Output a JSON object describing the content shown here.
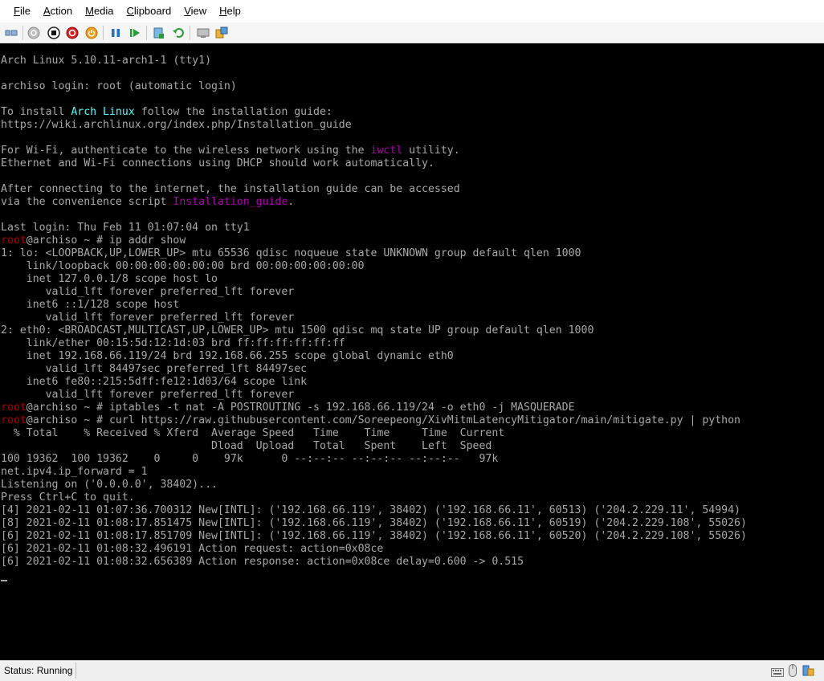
{
  "menu": [
    "File",
    "Action",
    "Media",
    "Clipboard",
    "View",
    "Help"
  ],
  "menu_underline": [
    "F",
    "A",
    "M",
    "C",
    "V",
    "H"
  ],
  "toolbar_icons": [
    "ctrl-alt-del-icon",
    "start-icon",
    "turn-off-icon",
    "shut-down-icon",
    "power-icon",
    "pause-icon",
    "resume-icon",
    "checkpoint-icon",
    "revert-icon",
    "enhanced-session-icon",
    "share-icon"
  ],
  "terminal": {
    "lines": [
      [
        {
          "t": "Arch Linux 5.10.11-arch1-1 (tty1)"
        }
      ],
      [
        {
          "t": ""
        }
      ],
      [
        {
          "t": "archiso login: root (automatic login)"
        }
      ],
      [
        {
          "t": ""
        }
      ],
      [
        {
          "t": "To install "
        },
        {
          "t": "Arch Linux",
          "c": "hl-cyan"
        },
        {
          "t": " follow the installation guide:"
        }
      ],
      [
        {
          "t": "https://wiki.archlinux.org/index.php/Installation_guide"
        }
      ],
      [
        {
          "t": ""
        }
      ],
      [
        {
          "t": "For Wi-Fi, authenticate to the wireless network using the "
        },
        {
          "t": "iwctl",
          "c": "hl-mag"
        },
        {
          "t": " utility."
        }
      ],
      [
        {
          "t": "Ethernet and Wi-Fi connections using DHCP should work automatically."
        }
      ],
      [
        {
          "t": ""
        }
      ],
      [
        {
          "t": "After connecting to the internet, the installation guide can be accessed"
        }
      ],
      [
        {
          "t": "via the convenience script "
        },
        {
          "t": "Installation_guide",
          "c": "hl-mag"
        },
        {
          "t": "."
        }
      ],
      [
        {
          "t": ""
        }
      ],
      [
        {
          "t": "Last login: Thu Feb 11 01:07:04 on tty1"
        }
      ],
      [
        {
          "t": "root",
          "c": "red"
        },
        {
          "t": "@archiso ~ # ip addr show"
        }
      ],
      [
        {
          "t": "1: lo: <LOOPBACK,UP,LOWER_UP> mtu 65536 qdisc noqueue state UNKNOWN group default qlen 1000"
        }
      ],
      [
        {
          "t": "    link/loopback 00:00:00:00:00:00 brd 00:00:00:00:00:00"
        }
      ],
      [
        {
          "t": "    inet 127.0.0.1/8 scope host lo"
        }
      ],
      [
        {
          "t": "       valid_lft forever preferred_lft forever"
        }
      ],
      [
        {
          "t": "    inet6 ::1/128 scope host"
        }
      ],
      [
        {
          "t": "       valid_lft forever preferred_lft forever"
        }
      ],
      [
        {
          "t": "2: eth0: <BROADCAST,MULTICAST,UP,LOWER_UP> mtu 1500 qdisc mq state UP group default qlen 1000"
        }
      ],
      [
        {
          "t": "    link/ether 00:15:5d:12:1d:03 brd ff:ff:ff:ff:ff:ff"
        }
      ],
      [
        {
          "t": "    inet 192.168.66.119/24 brd 192.168.66.255 scope global dynamic eth0"
        }
      ],
      [
        {
          "t": "       valid_lft 84497sec preferred_lft 84497sec"
        }
      ],
      [
        {
          "t": "    inet6 fe80::215:5dff:fe12:1d03/64 scope link"
        }
      ],
      [
        {
          "t": "       valid_lft forever preferred_lft forever"
        }
      ],
      [
        {
          "t": "root",
          "c": "red"
        },
        {
          "t": "@archiso ~ # iptables -t nat -A POSTROUTING -s 192.168.66.119/24 -o eth0 -j MASQUERADE"
        }
      ],
      [
        {
          "t": "root",
          "c": "red"
        },
        {
          "t": "@archiso ~ # curl https://raw.githubusercontent.com/Soreepeong/XivMitmLatencyMitigator/main/mitigate.py | python"
        }
      ],
      [
        {
          "t": "  % Total    % Received % Xferd  Average Speed   Time    Time     Time  Current"
        }
      ],
      [
        {
          "t": "                                 Dload  Upload   Total   Spent    Left  Speed"
        }
      ],
      [
        {
          "t": "100 19362  100 19362    0     0    97k      0 --:--:-- --:--:-- --:--:--   97k"
        }
      ],
      [
        {
          "t": "net.ipv4.ip_forward = 1"
        }
      ],
      [
        {
          "t": "Listening on ('0.0.0.0', 38402)..."
        }
      ],
      [
        {
          "t": "Press Ctrl+C to quit."
        }
      ],
      [
        {
          "t": "[4] 2021-02-11 01:07:36.700312 New[INTL]: ('192.168.66.119', 38402) ('192.168.66.11', 60513) ('204.2.229.11', 54994)"
        }
      ],
      [
        {
          "t": "[8] 2021-02-11 01:08:17.851475 New[INTL]: ('192.168.66.119', 38402) ('192.168.66.11', 60519) ('204.2.229.108', 55026)"
        }
      ],
      [
        {
          "t": "[6] 2021-02-11 01:08:17.851709 New[INTL]: ('192.168.66.119', 38402) ('192.168.66.11', 60520) ('204.2.229.108', 55026)"
        }
      ],
      [
        {
          "t": "[6] 2021-02-11 01:08:32.496191 Action request: action=0x08ce"
        }
      ],
      [
        {
          "t": "[6] 2021-02-11 01:08:32.656389 Action response: action=0x08ce delay=0.600 -> 0.515"
        }
      ]
    ]
  },
  "status": {
    "text": "Status: Running"
  },
  "tray_icons": [
    "keyboard-icon",
    "mouse-icon",
    "lock-icon"
  ]
}
